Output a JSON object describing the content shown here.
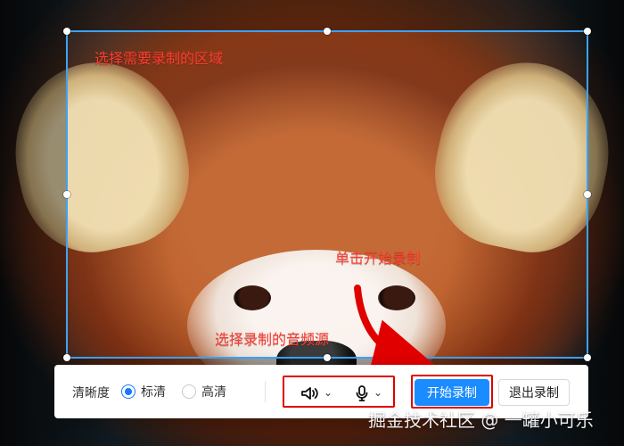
{
  "annotations": {
    "select_region": "选择需要录制的区域",
    "click_start": "单击开始录制",
    "select_audio_source": "选择录制的音频源"
  },
  "toolbar": {
    "clarity_label": "清晰度",
    "clarity_options": [
      "标清",
      "高清"
    ],
    "selected_clarity": "标清",
    "audio": {
      "speaker_icon": "speaker-icon",
      "mic_icon": "microphone-icon",
      "chevron_icon": "chevron-down-icon"
    },
    "start_button": "开始录制",
    "exit_button": "退出录制"
  },
  "watermark": "掘金技术社区 @ 一罐小可乐",
  "colors": {
    "selection_border": "#3aa3ff",
    "annotation_red": "#ff3b30",
    "primary_blue": "#1a8cff",
    "highlight_red": "#e00000"
  }
}
